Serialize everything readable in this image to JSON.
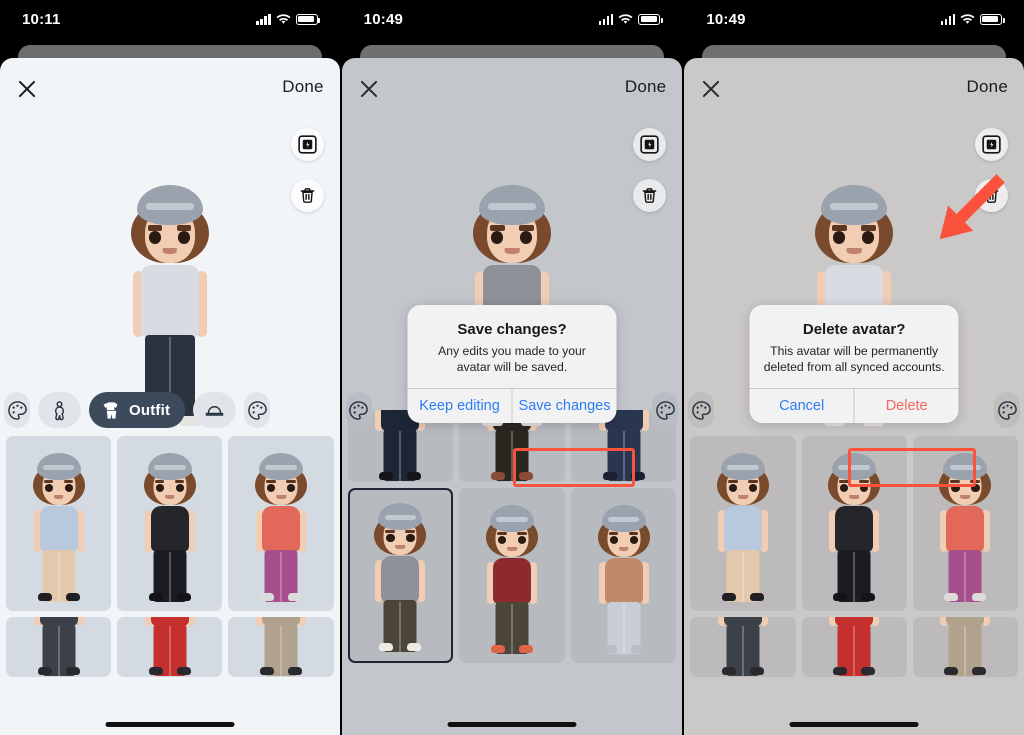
{
  "panels": [
    {
      "id": "editor",
      "status": {
        "time": "10:11",
        "signal_icon": "cellular-bars-icon",
        "wifi_icon": "wifi-icon",
        "battery_icon": "battery-icon"
      },
      "header": {
        "close_label": "close-icon",
        "done_label": "Done"
      },
      "actions": [
        {
          "name": "sticker-frame-icon",
          "label": "Create sticker"
        },
        {
          "name": "trash-icon",
          "label": "Delete avatar"
        }
      ],
      "tabs": [
        {
          "label": "",
          "icon": "palette-icon",
          "selected": false,
          "edge": true
        },
        {
          "label": "",
          "icon": "body-icon",
          "selected": false,
          "edge": false
        },
        {
          "label": "Outfit",
          "icon": "outfit-icon",
          "selected": true,
          "edge": false
        },
        {
          "label": "",
          "icon": "hat-icon",
          "selected": false,
          "edge": false
        },
        {
          "label": "",
          "icon": "palette-icon",
          "selected": false,
          "edge": true
        }
      ],
      "avatar": {
        "cap": "#9aa2ad",
        "hair": "#7a4a2c",
        "top": "#d8dce2",
        "bottom": "#2b3240",
        "shoes": "#e7e4e0"
      },
      "grid": [
        {
          "top": "#b9c9dd",
          "bottom": "#e4c9ad",
          "shoes": "#1f1f24"
        },
        {
          "top": "#25262b",
          "bottom": "#1b1c21",
          "shoes": "#141418"
        },
        {
          "top": "#e2685a",
          "bottom": "#a74f8c",
          "shoes": "#dcdcdc"
        },
        {
          "top": "#3c4049",
          "bottom": "#3c4049",
          "shoes": "#2a2a2e"
        },
        {
          "top": "#c5302e",
          "bottom": "#c5302e",
          "shoes": "#2a2a2e"
        },
        {
          "top": "#b0a28d",
          "bottom": "#b0a28d",
          "shoes": "#2a2a2e"
        }
      ],
      "dialog": null
    },
    {
      "id": "save-confirm",
      "status": {
        "time": "10:49",
        "signal_icon": "cellular-bars-icon",
        "wifi_icon": "wifi-icon",
        "battery_icon": "battery-icon"
      },
      "header": {
        "close_label": "close-icon",
        "done_label": "Done"
      },
      "actions": [
        {
          "name": "sticker-frame-icon",
          "label": "Create sticker"
        },
        {
          "name": "trash-icon",
          "label": "Delete avatar"
        }
      ],
      "tabs": [
        {
          "label": "",
          "icon": "palette-icon",
          "selected": false,
          "edge": true
        },
        {
          "label": "",
          "icon": "palette-icon",
          "selected": false,
          "edge": true
        }
      ],
      "avatar": {
        "cap": "#9aa2ad",
        "hair": "#7a4a2c",
        "top": "#8e9298",
        "bottom": "#4b4438",
        "shoes": "#e7e4e0"
      },
      "grid": [
        {
          "top": "#1d2636",
          "bottom": "#1d2636",
          "shoes": "#16161a"
        },
        {
          "top": "#2b2620",
          "bottom": "#2b2620",
          "shoes": "#8a4c36"
        },
        {
          "top": "#2a3650",
          "bottom": "#2a3650",
          "shoes": "#1a1f33"
        },
        {
          "top": "#8e9298",
          "bottom": "#4b4438",
          "shoes": "#efeae4"
        },
        {
          "top": "#8e2a2f",
          "bottom": "#4b4438",
          "shoes": "#e06448"
        },
        {
          "top": "#c08a6a",
          "bottom": "#c9cdd4",
          "shoes": "#b8bcc4"
        }
      ],
      "dialog": {
        "title": "Save changes?",
        "message": "Any edits you made to your avatar will be saved.",
        "buttons": [
          {
            "label": "Keep editing",
            "style": "blue",
            "highlighted": false
          },
          {
            "label": "Save changes",
            "style": "blue",
            "highlighted": true
          }
        ]
      }
    },
    {
      "id": "delete-confirm",
      "status": {
        "time": "10:49",
        "signal_icon": "cellular-bars-icon",
        "wifi_icon": "wifi-icon",
        "battery_icon": "battery-icon"
      },
      "header": {
        "close_label": "close-icon",
        "done_label": "Done"
      },
      "actions": [
        {
          "name": "sticker-frame-icon",
          "label": "Create sticker"
        },
        {
          "name": "trash-icon",
          "label": "Delete avatar"
        }
      ],
      "tabs": [
        {
          "label": "",
          "icon": "palette-icon",
          "selected": false,
          "edge": true
        },
        {
          "label": "",
          "icon": "palette-icon",
          "selected": false,
          "edge": true
        }
      ],
      "avatar": {
        "cap": "#9aa2ad",
        "hair": "#7a4a2c",
        "top": "#d8dce2",
        "bottom": "#2b3240",
        "shoes": "#e7e4e0"
      },
      "grid": [
        {
          "top": "#b9c9dd",
          "bottom": "#e4c9ad",
          "shoes": "#1f1f24"
        },
        {
          "top": "#25262b",
          "bottom": "#1b1c21",
          "shoes": "#141418"
        },
        {
          "top": "#e2685a",
          "bottom": "#a74f8c",
          "shoes": "#dcdcdc"
        },
        {
          "top": "#3c4049",
          "bottom": "#3c4049",
          "shoes": "#2a2a2e"
        },
        {
          "top": "#c5302e",
          "bottom": "#c5302e",
          "shoes": "#2a2a2e"
        },
        {
          "top": "#b0a28d",
          "bottom": "#b0a28d",
          "shoes": "#2a2a2e"
        }
      ],
      "dialog": {
        "title": "Delete avatar?",
        "message": "This avatar will be permanently deleted from all synced accounts.",
        "buttons": [
          {
            "label": "Cancel",
            "style": "blue",
            "highlighted": false
          },
          {
            "label": "Delete",
            "style": "red",
            "highlighted": true
          }
        ]
      }
    }
  ],
  "annotations": {
    "highlight_color": "#fa523c",
    "arrow_target": "trash-icon"
  }
}
